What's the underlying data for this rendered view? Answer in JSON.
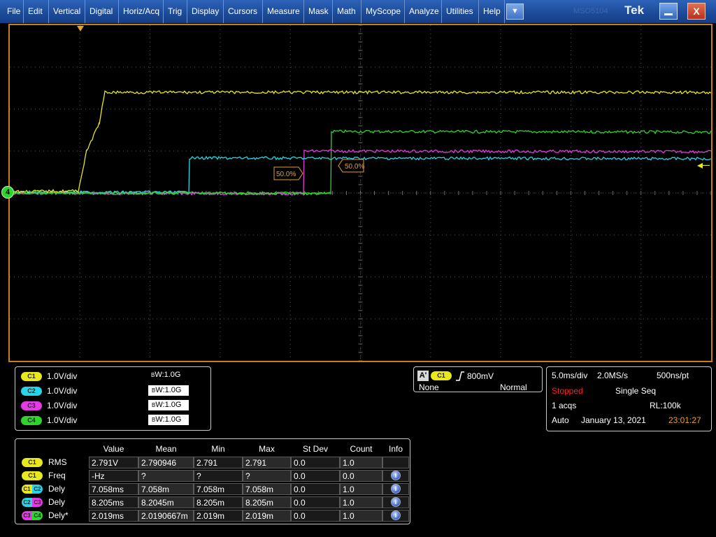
{
  "menu": {
    "items": [
      "File",
      "Edit",
      "Vertical",
      "Digital",
      "Horiz/Acq",
      "Trig",
      "Display",
      "Cursors",
      "Measure",
      "Mask",
      "Math",
      "MyScope",
      "Analyze",
      "Utilities",
      "Help"
    ],
    "arrow": "▼",
    "ghost_text": "MSO5104",
    "brand": "Tek",
    "close": "X"
  },
  "colors": {
    "ch1": "#e8e81c",
    "ch2": "#26d6e8",
    "ch3": "#e43ae4",
    "ch4": "#2ed42e",
    "accent": "#c8801a"
  },
  "graticule": {
    "ground_marker": "4",
    "cursor_label_1": "50.0%",
    "cursor_label_2": "50.0%"
  },
  "channels": [
    {
      "badge": "C1",
      "scale": "1.0V/div",
      "bw": "1.0G",
      "bw_boxed": false
    },
    {
      "badge": "C2",
      "scale": "1.0V/div",
      "bw": "1.0G",
      "bw_boxed": true
    },
    {
      "badge": "C3",
      "scale": "1.0V/div",
      "bw": "1.0G",
      "bw_boxed": true
    },
    {
      "badge": "C4",
      "scale": "1.0V/div",
      "bw": "1.0G",
      "bw_boxed": true
    }
  ],
  "trigger": {
    "a_label": "A'",
    "source": "C1",
    "level": "800mV",
    "coupling": "None",
    "mode": "Normal"
  },
  "horizontal": {
    "timebase": "5.0ms/div",
    "sample_rate": "2.0MS/s",
    "resolution": "500ns/pt",
    "state": "Stopped",
    "acq_mode": "Single Seq",
    "acqs": "1 acqs",
    "record_length": "RL:100k",
    "trigger_mode": "Auto",
    "date": "January 13, 2021",
    "time": "23:01:27"
  },
  "measurements": {
    "headers": [
      "Value",
      "Mean",
      "Min",
      "Max",
      "St Dev",
      "Count",
      "Info"
    ],
    "rows": [
      {
        "src": "C1",
        "src2": "",
        "name": "RMS",
        "value": "2.791V",
        "mean": "2.790946",
        "min": "2.791",
        "max": "2.791",
        "stdev": "0.0",
        "count": "1.0",
        "info": ""
      },
      {
        "src": "C1",
        "src2": "",
        "name": "Freq",
        "value": "-Hz",
        "mean": "?",
        "min": "?",
        "max": "?",
        "stdev": "0.0",
        "count": "0.0",
        "info": "i"
      },
      {
        "src": "C1",
        "src2": "C2",
        "name": "Dely",
        "value": "7.058ms",
        "mean": "7.058m",
        "min": "7.058m",
        "max": "7.058m",
        "stdev": "0.0",
        "count": "1.0",
        "info": "i"
      },
      {
        "src": "C2",
        "src2": "C3",
        "name": "Dely",
        "value": "8.205ms",
        "mean": "8.2045m",
        "min": "8.205m",
        "max": "8.205m",
        "stdev": "0.0",
        "count": "1.0",
        "info": "i"
      },
      {
        "src": "C3",
        "src2": "C4",
        "name": "Dely*",
        "value": "2.019ms",
        "mean": "2.0190667m",
        "min": "2.019m",
        "max": "2.019m",
        "stdev": "0.0",
        "count": "1.0",
        "info": "i"
      }
    ]
  }
}
